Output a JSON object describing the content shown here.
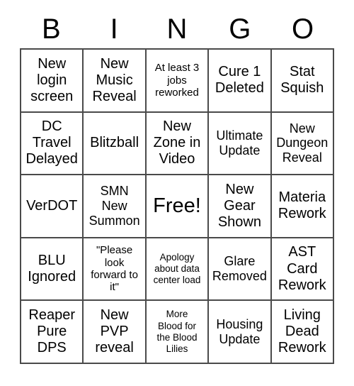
{
  "card": {
    "title_letters": [
      "B",
      "I",
      "N",
      "G",
      "O"
    ],
    "free_space_label": "Free!",
    "colors": {
      "background": "#ffffff",
      "cell_background": "#ffffff",
      "border": "#4a4a4a",
      "text": "#000000"
    },
    "rows": [
      [
        {
          "text": "New\nlogin\nscreen",
          "size": "lg"
        },
        {
          "text": "New\nMusic\nReveal",
          "size": "lg"
        },
        {
          "text": "At least 3\njobs\nreworked",
          "size": "sm"
        },
        {
          "text": "Cure 1\nDeleted",
          "size": "lg"
        },
        {
          "text": "Stat\nSquish",
          "size": "lg"
        }
      ],
      [
        {
          "text": "DC\nTravel\nDelayed",
          "size": "lg"
        },
        {
          "text": "Blitzball",
          "size": "lg"
        },
        {
          "text": "New\nZone in\nVideo",
          "size": "lg"
        },
        {
          "text": "Ultimate\nUpdate",
          "size": "md"
        },
        {
          "text": "New\nDungeon\nReveal",
          "size": "md"
        }
      ],
      [
        {
          "text": "VerDOT",
          "size": "lg"
        },
        {
          "text": "SMN\nNew\nSummon",
          "size": "md"
        },
        {
          "text": "Free!",
          "size": "xl"
        },
        {
          "text": "New\nGear\nShown",
          "size": "lg"
        },
        {
          "text": "Materia\nRework",
          "size": "lg"
        }
      ],
      [
        {
          "text": "BLU\nIgnored",
          "size": "lg"
        },
        {
          "text": "\"Please\nlook\nforward to\nit\"",
          "size": "sm"
        },
        {
          "text": "Apology\nabout data\ncenter load",
          "size": "xs"
        },
        {
          "text": "Glare\nRemoved",
          "size": "md"
        },
        {
          "text": "AST\nCard\nRework",
          "size": "lg"
        }
      ],
      [
        {
          "text": "Reaper\nPure\nDPS",
          "size": "lg"
        },
        {
          "text": "New\nPVP\nreveal",
          "size": "lg"
        },
        {
          "text": "More\nBlood for\nthe Blood\nLilies",
          "size": "xs"
        },
        {
          "text": "Housing\nUpdate",
          "size": "md"
        },
        {
          "text": "Living\nDead\nRework",
          "size": "lg"
        }
      ]
    ]
  }
}
